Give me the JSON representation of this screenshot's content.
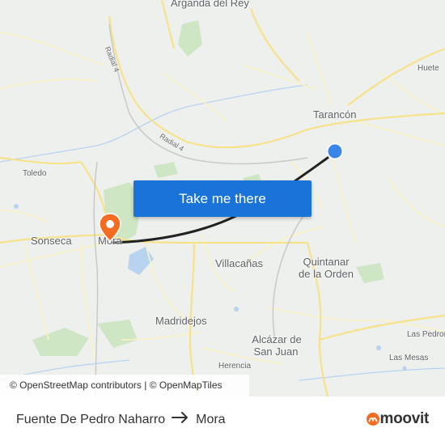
{
  "map": {
    "places": [
      {
        "id": "arganda",
        "name": "Arganda del Rey"
      },
      {
        "id": "huete",
        "name": "Huete"
      },
      {
        "id": "tarancon",
        "name": "Tarancón"
      },
      {
        "id": "toledo",
        "name": "Toledo"
      },
      {
        "id": "sonseca",
        "name": "Sonseca"
      },
      {
        "id": "mora",
        "name": "Mora"
      },
      {
        "id": "villacanas",
        "name": "Villacañas"
      },
      {
        "id": "quintanar_1",
        "name": "Quintanar"
      },
      {
        "id": "quintanar_2",
        "name": "de la Orden"
      },
      {
        "id": "madridejos",
        "name": "Madridejos"
      },
      {
        "id": "alcazar_1",
        "name": "Alcázar de"
      },
      {
        "id": "alcazar_2",
        "name": "San Juan"
      },
      {
        "id": "herencia",
        "name": "Herencia"
      },
      {
        "id": "las_pedroneras",
        "name": "Las Pedroñ"
      },
      {
        "id": "las_mesas",
        "name": "Las Mesas"
      }
    ],
    "roads": [
      {
        "id": "radial4_a",
        "name": "Radial 4"
      },
      {
        "id": "radial4_b",
        "name": "Radial 4"
      }
    ],
    "origin_marker": "blue-location-dot",
    "destination_marker": "orange-pin",
    "route_line_color": "#222222",
    "accent_color": "#1a73d9"
  },
  "cta": {
    "label": "Take me there"
  },
  "attribution": {
    "osm": "© OpenStreetMap contributors",
    "separator": "|",
    "omt": "© OpenMapTiles"
  },
  "footer": {
    "origin": "Fuente De Pedro Naharro",
    "destination": "Mora",
    "arrow_icon": "arrow-right-icon",
    "brand": "moovit",
    "brand_color": "#f26d21"
  }
}
